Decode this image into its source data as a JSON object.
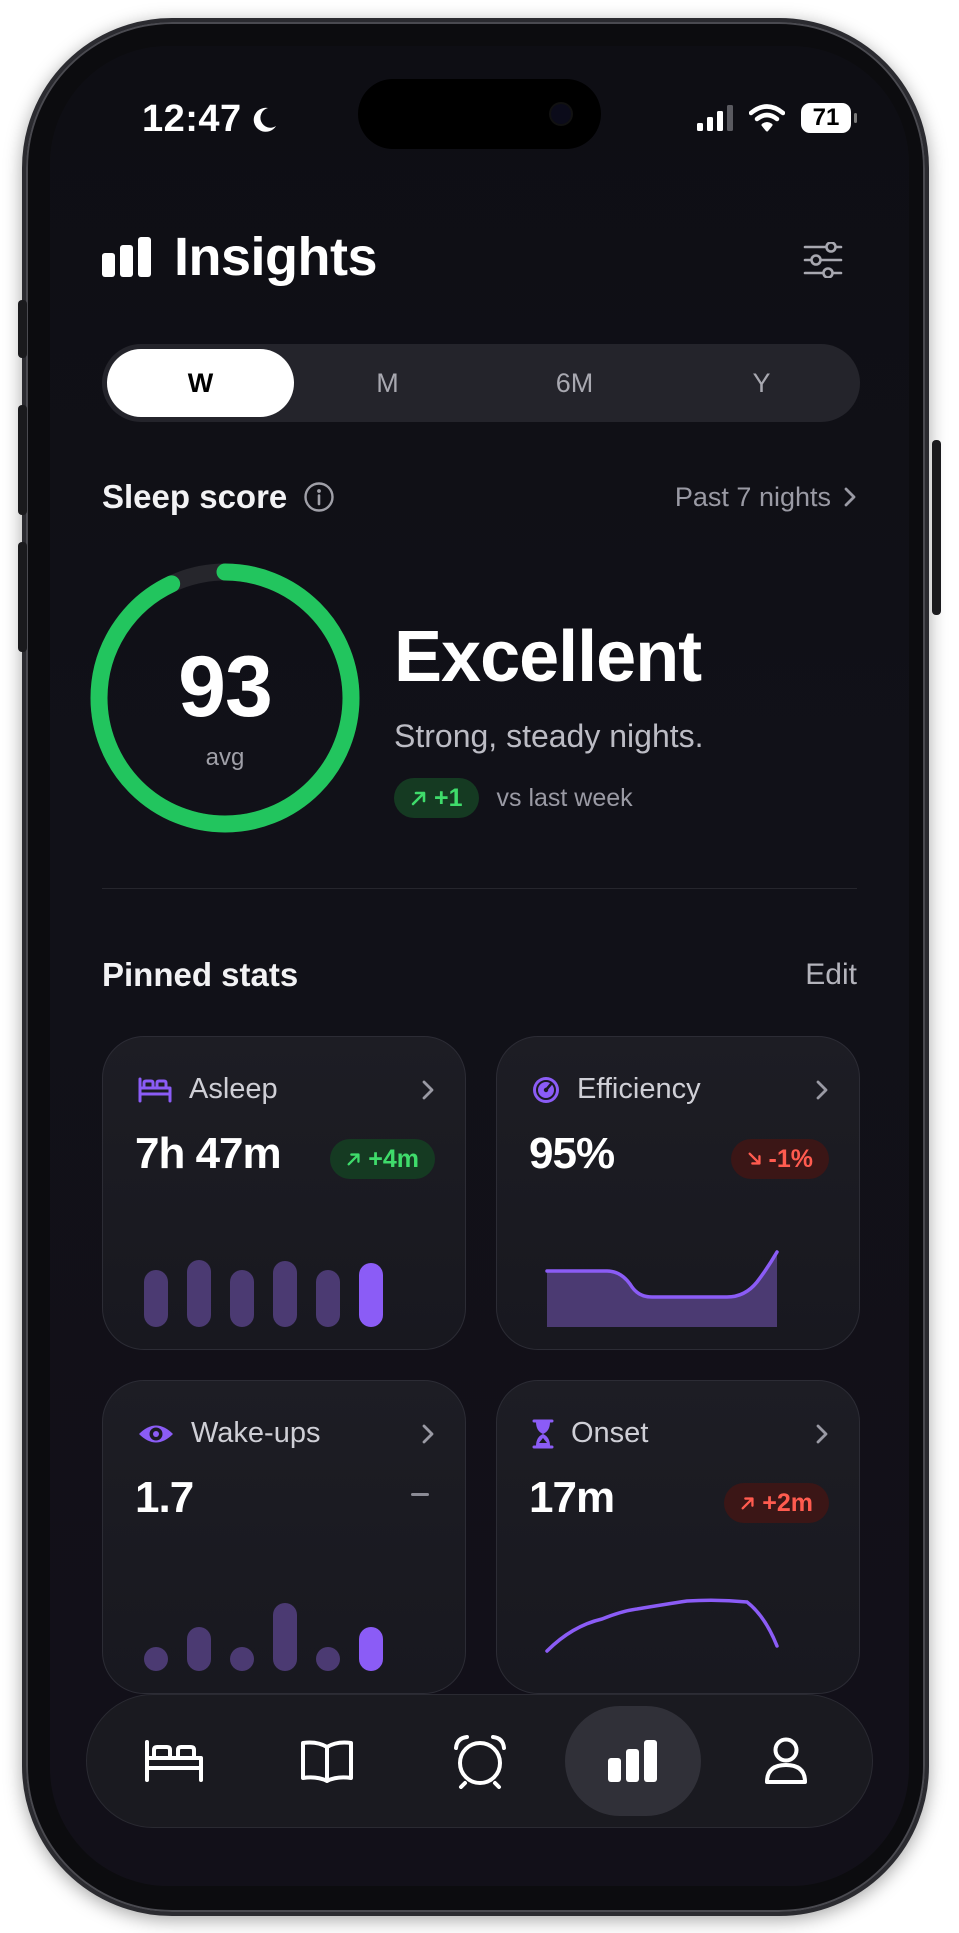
{
  "status_bar": {
    "time": "12:47",
    "battery": "71"
  },
  "header": {
    "title": "Insights"
  },
  "range_tabs": [
    {
      "label": "W",
      "active": true
    },
    {
      "label": "M",
      "active": false
    },
    {
      "label": "6M",
      "active": false
    },
    {
      "label": "Y",
      "active": false
    }
  ],
  "sleep_score": {
    "title": "Sleep score",
    "link": "Past 7 nights",
    "value": "93",
    "value_sub": "avg",
    "progress_fraction": 0.93,
    "rating": "Excellent",
    "description": "Strong, steady nights.",
    "delta": "+1",
    "delta_caption": "vs last week",
    "accent": "#22c55e"
  },
  "pinned": {
    "title": "Pinned stats",
    "edit_label": "Edit",
    "cards": [
      {
        "label": "Asleep",
        "value": "7h 47m",
        "delta": "+4m",
        "trend": "up"
      },
      {
        "label": "Efficiency",
        "value": "95%",
        "delta": "-1%",
        "trend": "down"
      },
      {
        "label": "Wake-ups",
        "value": "1.7",
        "delta": "–",
        "trend": "flat"
      },
      {
        "label": "Onset",
        "value": "17m",
        "delta": "+2m",
        "trend": "up-bad"
      }
    ]
  },
  "tab_bar": {
    "items": [
      "bed-icon",
      "book-icon",
      "alarm-clock-icon",
      "chart-bars-icon",
      "profile-icon"
    ],
    "active_index": 3
  },
  "colors": {
    "purple": "#8b5cf6",
    "purple_dim": "#4b3a72",
    "green": "#22c55e",
    "red": "#ff5b4f"
  }
}
